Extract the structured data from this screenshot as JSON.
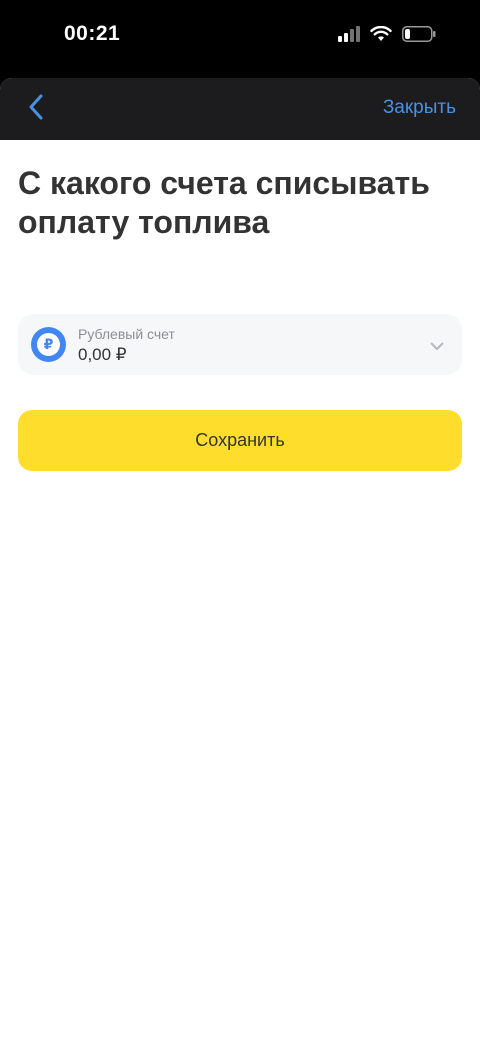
{
  "status_bar": {
    "time": "00:21",
    "icons": [
      "cellular-signal-icon",
      "wifi-icon",
      "battery-icon"
    ]
  },
  "nav": {
    "back_icon": "chevron-left-icon",
    "close_label": "Закрыть"
  },
  "title": "С какого счета списывать оплату топлива",
  "account": {
    "icon": "ruble-icon",
    "icon_glyph": "₽",
    "name": "Рублевый счет",
    "balance": "0,00 ₽",
    "dropdown_icon": "chevron-down-icon"
  },
  "save_button_label": "Сохранить",
  "colors": {
    "accent_blue": "#4a90e2",
    "button_yellow": "#ffdd2d",
    "nav_background": "#1c1c1e",
    "ruble_icon_blue": "#4287f5"
  }
}
